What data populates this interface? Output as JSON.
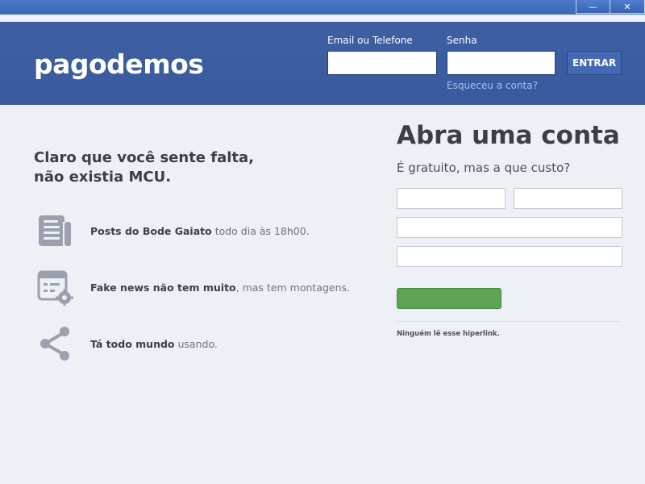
{
  "window": {
    "minimize_glyph": "—",
    "close_glyph": "✕"
  },
  "header": {
    "logo": "pagodemos",
    "email_label": "Email ou Telefone",
    "email_value": "",
    "password_label": "Senha",
    "password_value": "",
    "enter_button": "ENTRAR",
    "forgot_link": "Esqueceu a conta?"
  },
  "left": {
    "tagline_line1": "Claro que você sente falta,",
    "tagline_line2": "não existia MCU.",
    "features": [
      {
        "icon": "newspaper-icon",
        "bold": "Posts do Bode Gaiato",
        "rest": " todo dia às 18h00."
      },
      {
        "icon": "fake-news-icon",
        "bold": "Fake news não tem muito",
        "rest": ", mas tem montagens."
      },
      {
        "icon": "share-icon",
        "bold": "Tá todo mundo",
        "rest": " usando."
      }
    ]
  },
  "signup": {
    "title": "Abra uma conta",
    "subtitle": "É gratuito, mas a que custo?",
    "first_name_value": "",
    "last_name_value": "",
    "field3_value": "",
    "field4_value": "",
    "submit_label": "",
    "footer_text": "Ninguém lê esse hiperlink."
  },
  "colors": {
    "header_blue": "#3b5998",
    "background": "#edf0f5",
    "signup_green": "#5ea453",
    "link_blue": "#a8bff0",
    "icon_gray": "#9aa0ae"
  }
}
